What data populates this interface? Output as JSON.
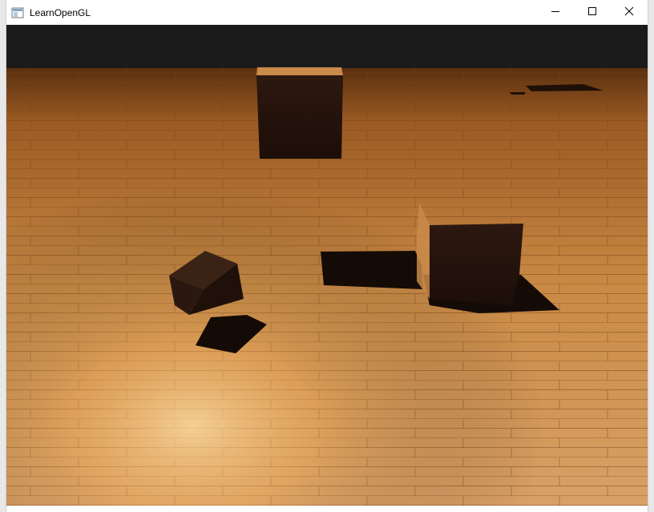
{
  "window": {
    "title": "LearnOpenGL"
  },
  "caption_buttons": {
    "minimize_icon": "minimize-icon",
    "maximize_icon": "maximize-icon",
    "close_icon": "close-icon"
  },
  "scene": {
    "sky_color": "#1b1b1b",
    "floor_color_light": "#e8a657",
    "floor_color_dark": "#8a4f1c",
    "cube_color": "#2a1710",
    "shadow_color": "#150b06"
  }
}
